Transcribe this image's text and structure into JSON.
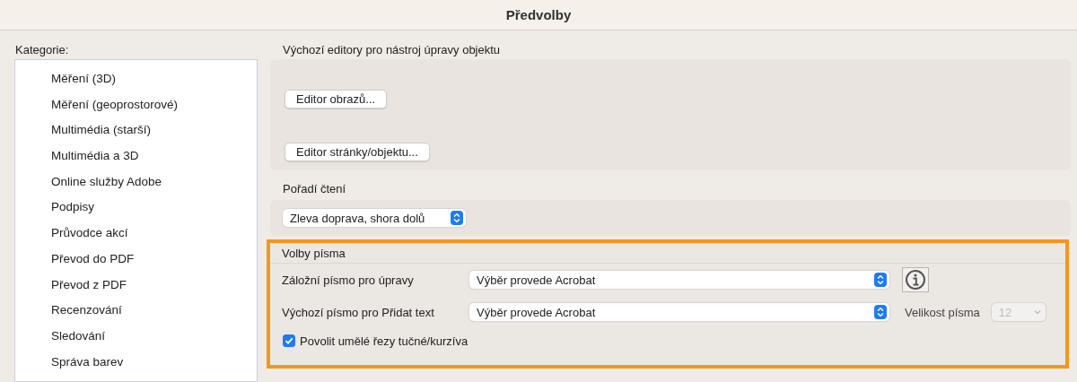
{
  "window": {
    "title": "Předvolby"
  },
  "sidebar": {
    "label": "Kategorie:",
    "items": [
      {
        "label": "Měření (3D)",
        "selected": false
      },
      {
        "label": "Měření (geoprostorové)",
        "selected": false
      },
      {
        "label": "Multimédia (starší)",
        "selected": false
      },
      {
        "label": "Multimédia a 3D",
        "selected": false
      },
      {
        "label": "Online služby Adobe",
        "selected": false
      },
      {
        "label": "Podpisy",
        "selected": false
      },
      {
        "label": "Průvodce akcí",
        "selected": false
      },
      {
        "label": "Převod do PDF",
        "selected": false
      },
      {
        "label": "Převod z PDF",
        "selected": false
      },
      {
        "label": "Recenzování",
        "selected": false
      },
      {
        "label": "Sledování",
        "selected": false
      },
      {
        "label": "Správa barev",
        "selected": false
      }
    ]
  },
  "object_editors": {
    "title": "Výchozí editory pro nástroj úpravy objektu",
    "buttons": [
      "Editor obrazů...",
      "Editor stránky/objektu..."
    ]
  },
  "reading_order": {
    "title": "Pořadí čtení",
    "dropdown": {
      "value": "Zleva doprava, shora dolů"
    }
  },
  "font_options": {
    "title": "Volby písma",
    "highlighted": true,
    "fallback_font": {
      "label": "Záložní písmo pro úpravy",
      "value": "Výběr provede Acrobat"
    },
    "default_font": {
      "label": "Výchozí písmo pro Přidat text",
      "value": "Výběr provede Acrobat"
    },
    "font_size": {
      "label": "Velikost písma",
      "value": "12",
      "disabled": true
    },
    "synthetic_styles": {
      "label": "Povolit umělé řezy tučné/kurzíva",
      "checked": true
    }
  }
}
